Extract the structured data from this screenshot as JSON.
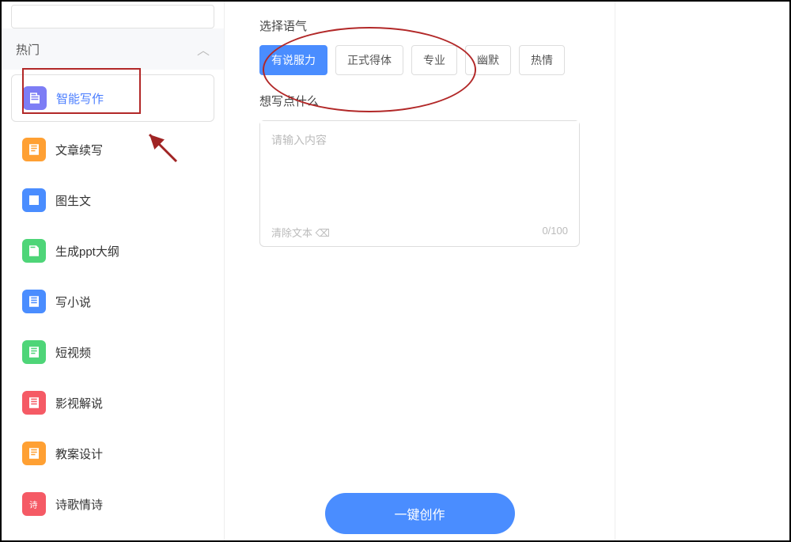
{
  "sidebar": {
    "category": "热门",
    "items": [
      {
        "label": "智能写作",
        "icon": "doc-purple",
        "active": true
      },
      {
        "label": "文章续写",
        "icon": "doc-orange",
        "active": false
      },
      {
        "label": "图生文",
        "icon": "img-blue",
        "active": false
      },
      {
        "label": "生成ppt大纲",
        "icon": "doc-green",
        "active": false
      },
      {
        "label": "写小说",
        "icon": "doc-blue",
        "active": false
      },
      {
        "label": "短视频",
        "icon": "doc-green2",
        "active": false
      },
      {
        "label": "影视解说",
        "icon": "doc-red",
        "active": false
      },
      {
        "label": "教案设计",
        "icon": "doc-orange2",
        "active": false
      },
      {
        "label": "诗歌情诗",
        "icon": "poem-red",
        "active": false
      }
    ]
  },
  "main": {
    "tone_label": "选择语气",
    "tones": [
      {
        "label": "有说服力",
        "selected": true
      },
      {
        "label": "正式得体",
        "selected": false
      },
      {
        "label": "专业",
        "selected": false
      },
      {
        "label": "幽默",
        "selected": false
      },
      {
        "label": "热情",
        "selected": false
      }
    ],
    "prompt_label": "想写点什么",
    "placeholder": "请输入内容",
    "clear_label": "清除文本 ⌫",
    "counter": "0/100",
    "submit_label": "一键创作"
  }
}
